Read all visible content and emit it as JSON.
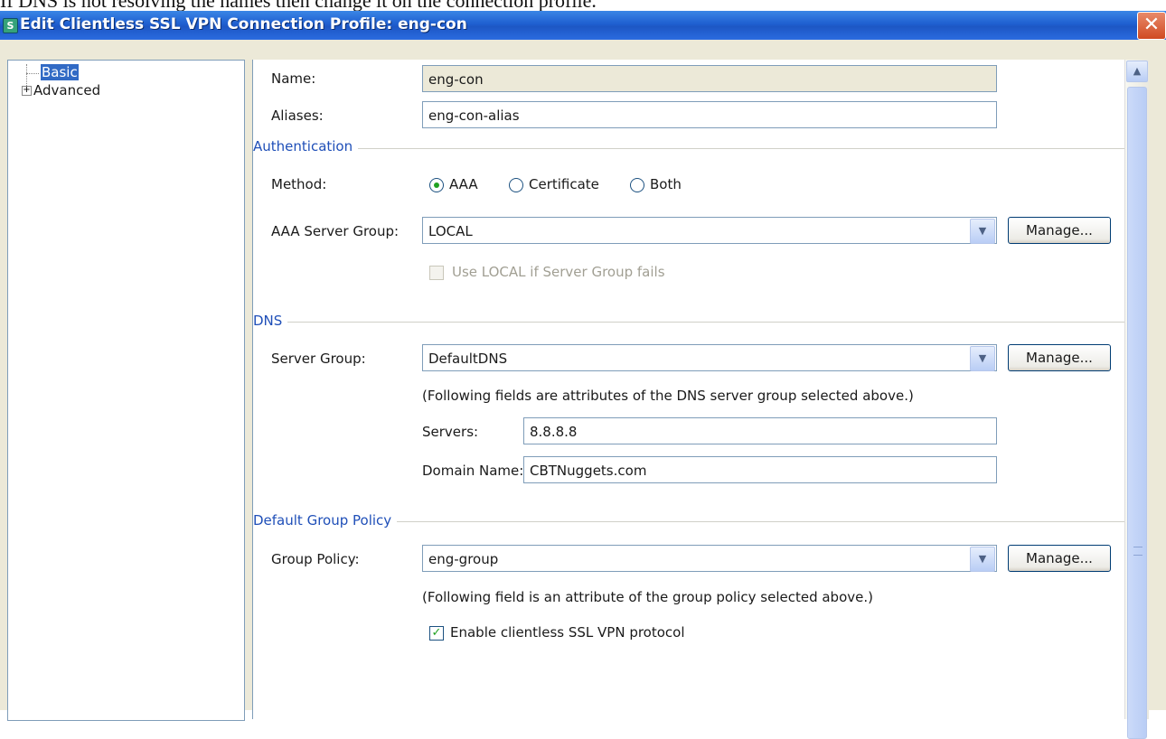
{
  "caption": "If DNS is not resolving the names then change it on the connection profile.",
  "window": {
    "title": "Edit Clientless SSL VPN Connection Profile: eng-con",
    "close_glyph": "✕",
    "icon": "app-icon"
  },
  "tree": {
    "items": [
      {
        "label": "Basic",
        "selected": true
      },
      {
        "label": "Advanced",
        "expandable": true
      }
    ]
  },
  "basic": {
    "name_label": "Name:",
    "name_value": "eng-con",
    "aliases_label": "Aliases:",
    "aliases_value": "eng-con-alias"
  },
  "authentication": {
    "section_title": "Authentication",
    "method_label": "Method:",
    "methods": [
      "AAA",
      "Certificate",
      "Both"
    ],
    "selected_method": "AAA",
    "server_group_label": "AAA Server Group:",
    "server_group_value": "LOCAL",
    "manage_label": "Manage...",
    "fallback_label": "Use LOCAL if Server Group fails",
    "fallback_checked": false,
    "fallback_enabled": false
  },
  "dns": {
    "section_title": "DNS",
    "server_group_label": "Server Group:",
    "server_group_value": "DefaultDNS",
    "manage_label": "Manage...",
    "note": "(Following fields are attributes of the DNS server group selected above.)",
    "servers_label": "Servers:",
    "servers_value": "8.8.8.8",
    "domain_label": "Domain Name:",
    "domain_value": "CBTNuggets.com"
  },
  "group_policy": {
    "section_title": "Default Group Policy",
    "policy_label": "Group Policy:",
    "policy_value": "eng-group",
    "manage_label": "Manage...",
    "note": "(Following field is an attribute of the group policy selected above.)",
    "enable_label": "Enable clientless SSL VPN protocol",
    "enable_checked": true
  },
  "colors": {
    "titlebar": "#1f5fd0",
    "section_title": "#1f4fb8",
    "selection": "#316ac5",
    "radio_dot": "#21a121"
  }
}
